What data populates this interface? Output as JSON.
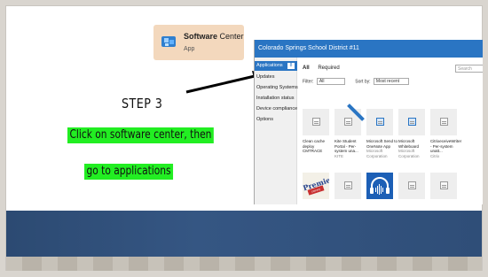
{
  "search_result": {
    "title_bold": "Software",
    "title_rest": " Center",
    "subtitle": "App",
    "icon": "software-center-icon"
  },
  "instructions": {
    "step": "STEP 3",
    "line1": "Click on software center, then",
    "line2": "go to applications"
  },
  "software_center": {
    "window_title": "Colorado Springs School District #11",
    "nav": [
      {
        "label": "Applications",
        "count": "8",
        "active": true
      },
      {
        "label": "Updates"
      },
      {
        "label": "Operating Systems"
      },
      {
        "label": "Installation status"
      },
      {
        "label": "Device compliance"
      },
      {
        "label": "Options"
      }
    ],
    "tabs": {
      "all": "All",
      "required": "Required"
    },
    "search_placeholder": "Search",
    "filter_label": "Filter:",
    "filter_value": "All",
    "sort_label": "Sort by:",
    "sort_value": "Most recent",
    "apps": [
      {
        "name": "Clean cache deploy CMTRACE",
        "publisher": ""
      },
      {
        "name": "Kite Student Portal - Per-system una...",
        "publisher": "KITE"
      },
      {
        "name": "Microsoft Send to OneNote App",
        "publisher": "Microsoft Corporation"
      },
      {
        "name": "Microsoft Whiteboard",
        "publisher": "Microsoft Corporation"
      },
      {
        "name": "CitrixeceiveWriter - Per-system unatt...",
        "publisher": "Citrix"
      }
    ],
    "premier_logo": {
      "text": "Premier",
      "sub": "Literacy"
    }
  },
  "colors": {
    "highlight": "#22ee22",
    "accent": "#2a75c3",
    "band": "#2f4e78"
  }
}
